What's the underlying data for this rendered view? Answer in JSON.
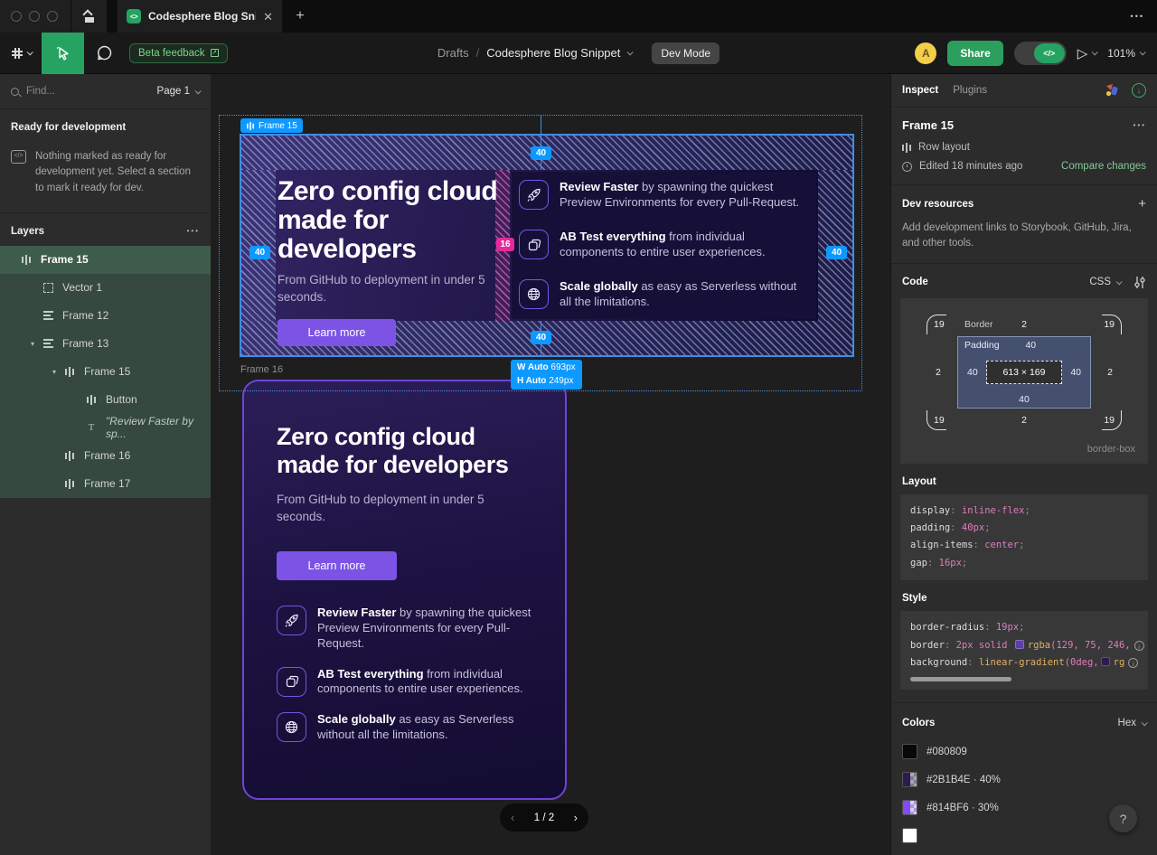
{
  "window": {
    "tab_title": "Codesphere Blog Snippet",
    "close_glyph": "✕",
    "new_tab_glyph": "+",
    "menu_dots": "•••"
  },
  "toolbar": {
    "beta_badge": "Beta feedback",
    "breadcrumb_folder": "Drafts",
    "breadcrumb_sep": "/",
    "breadcrumb_file": "Codesphere Blog Snippet",
    "dev_mode_label": "Dev Mode",
    "avatar_initial": "A",
    "share_label": "Share",
    "toggle_knob": "</>",
    "play_glyph": "▷",
    "zoom_level": "101%"
  },
  "sidebar": {
    "search_placeholder": "Find...",
    "page_selector": "Page 1",
    "ready_title": "Ready for development",
    "ready_icon_glyph": "</>",
    "ready_message": "Nothing marked as ready for development yet. Select a section to mark it ready for dev.",
    "layers_title": "Layers",
    "layers_menu": "•••",
    "layers": [
      {
        "label": "Frame 15",
        "icon": "row",
        "indent": 0,
        "state": "sel",
        "chev": false
      },
      {
        "label": "Vector 1",
        "icon": "vector",
        "indent": 1,
        "state": "child",
        "chev": false
      },
      {
        "label": "Frame 12",
        "icon": "col",
        "indent": 1,
        "state": "child",
        "chev": false
      },
      {
        "label": "Frame 13",
        "icon": "col",
        "indent": 1,
        "state": "child",
        "chev": true
      },
      {
        "label": "Frame 15",
        "icon": "row",
        "indent": 2,
        "state": "child",
        "chev": true
      },
      {
        "label": "Button",
        "icon": "row",
        "indent": 3,
        "state": "child",
        "chev": false
      },
      {
        "label": "\"Review Faster by sp...",
        "icon": "text",
        "indent": 3,
        "state": "child",
        "chev": false,
        "italic": true
      },
      {
        "label": "Frame 16",
        "icon": "row",
        "indent": 2,
        "state": "child",
        "chev": false
      },
      {
        "label": "Frame 17",
        "icon": "row",
        "indent": 2,
        "state": "child",
        "chev": false
      }
    ]
  },
  "canvas": {
    "frame_label": "Frame 15",
    "frame16_label": "Frame 16",
    "pad_top": "40",
    "pad_bottom": "40",
    "pad_left": "40",
    "pad_right": "40",
    "gap": "16",
    "size_w_bold": "W Auto",
    "size_w_rest": "693px",
    "size_h_bold": "H Auto",
    "size_h_rest": "249px",
    "heading": "Zero config cloud made for developers",
    "subtext": "From GitHub to deployment in under 5 seconds.",
    "cta_label": "Learn more",
    "features": [
      {
        "icon": "rocket",
        "bold": "Review Faster",
        "rest": " by spawning the quickest Preview Environments for every Pull-Request."
      },
      {
        "icon": "copies",
        "bold": "AB Test everything",
        "rest": " from individual components to entire user experiences."
      },
      {
        "icon": "globe",
        "bold": "Scale globally",
        "rest": " as easy as Serverless without all the limitations."
      }
    ],
    "pager_prev": "‹",
    "pager_num": "1 / 2",
    "pager_next": "›"
  },
  "inspector": {
    "tab_inspect": "Inspect",
    "tab_plugins": "Plugins",
    "selection_name": "Frame 15",
    "selection_menu": "•••",
    "layout_type": "Row layout",
    "edited": "Edited 18 minutes ago",
    "compare_link": "Compare changes",
    "devres_title": "Dev resources",
    "devres_plus": "+",
    "devres_desc": "Add development links to Storybook, GitHub, Jira, and other tools.",
    "code_title": "Code",
    "code_language": "CSS",
    "box_model": {
      "radius": "19",
      "border_w": "2",
      "padding_w": "40",
      "border_label": "Border",
      "padding_label": "Padding",
      "content": "613 × 169",
      "sizing": "border-box"
    },
    "layout_title": "Layout",
    "layout_lines": [
      [
        [
          "prop",
          "display"
        ],
        [
          "punc",
          ": "
        ],
        [
          "val",
          "inline-flex"
        ],
        [
          "punc",
          ";"
        ]
      ],
      [
        [
          "prop",
          "padding"
        ],
        [
          "punc",
          ": "
        ],
        [
          "val",
          "40px"
        ],
        [
          "punc",
          ";"
        ]
      ],
      [
        [
          "prop",
          "align-items"
        ],
        [
          "punc",
          ": "
        ],
        [
          "val",
          "center"
        ],
        [
          "punc",
          ";"
        ]
      ],
      [
        [
          "prop",
          "gap"
        ],
        [
          "punc",
          ": "
        ],
        [
          "val",
          "16px"
        ],
        [
          "punc",
          ";"
        ]
      ]
    ],
    "style_title": "Style",
    "style_lines": [
      [
        [
          "prop",
          "border-radius"
        ],
        [
          "punc",
          ": "
        ],
        [
          "val",
          "19px"
        ],
        [
          "punc",
          ";"
        ]
      ],
      [
        [
          "prop",
          "border"
        ],
        [
          "punc",
          ": "
        ],
        [
          "val",
          "2px solid"
        ],
        [
          "swatch",
          "#5B3FA8"
        ],
        [
          "fn",
          "rgba"
        ],
        [
          "num",
          "(129, 75, 246,"
        ],
        [
          "info",
          "i"
        ]
      ],
      [
        [
          "prop",
          "background"
        ],
        [
          "punc",
          ": "
        ],
        [
          "fn",
          "linear-gradient"
        ],
        [
          "num",
          "(0deg,"
        ],
        [
          "swatch",
          "#2B1B4E"
        ],
        [
          "fn",
          "rg"
        ],
        [
          "info",
          "i"
        ]
      ]
    ],
    "colors_title": "Colors",
    "colors_format": "Hex",
    "colors": [
      {
        "label": "#080809",
        "solid": "#080809",
        "overlay": ""
      },
      {
        "label": "#2B1B4E · 40%",
        "solid": "#2B1B4E",
        "overlay": "rgba(43,27,78,0.4)"
      },
      {
        "label": "#814BF6 · 30%",
        "solid": "#814BF6",
        "overlay": "rgba(129,75,246,0.3)"
      },
      {
        "label": "",
        "solid": "#FFFFFF",
        "overlay": "rgba(255,255,255,1)"
      }
    ],
    "help_glyph": "?"
  }
}
